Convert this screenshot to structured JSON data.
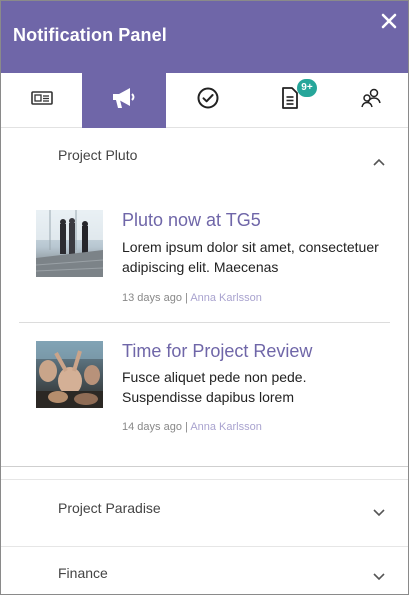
{
  "header": {
    "title": "Notification Panel",
    "close_icon": "close-icon"
  },
  "tabs": [
    {
      "icon": "news-icon",
      "active": false
    },
    {
      "icon": "megaphone-icon",
      "active": true
    },
    {
      "icon": "check-circle-icon",
      "active": false
    },
    {
      "icon": "document-icon",
      "active": false,
      "badge": "9+"
    },
    {
      "icon": "users-icon",
      "active": false
    }
  ],
  "sections": [
    {
      "label": "Project Pluto",
      "expanded": true,
      "items": [
        {
          "title": "Pluto now at TG5",
          "body": "Lorem ipsum dolor sit amet, consectetuer adipiscing elit. Maecenas",
          "age": "13 days ago",
          "separator": "|",
          "author": "Anna Karlsson"
        },
        {
          "title": "Time for Project Review",
          "body": "Fusce aliquet pede non pede. Suspendisse dapibus lorem",
          "age": "14 days ago",
          "separator": "|",
          "author": "Anna Karlsson"
        }
      ]
    },
    {
      "label": "Project Paradise",
      "expanded": false
    },
    {
      "label": "Finance",
      "expanded": false
    }
  ],
  "colors": {
    "accent": "#6f66a8",
    "badge": "#26a69a",
    "author_link": "#a9a3cf"
  }
}
